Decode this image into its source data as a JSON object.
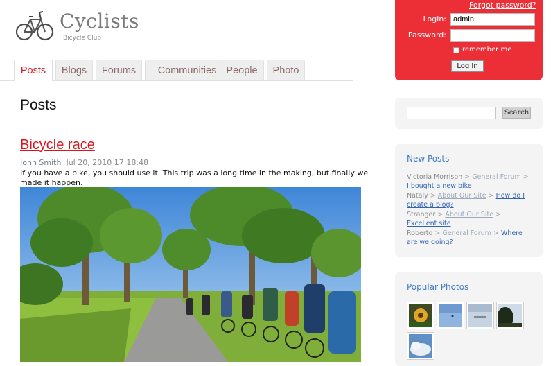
{
  "header": {
    "site_title": "Cyclists",
    "site_subtitle": "Bicycle Club"
  },
  "tabs": [
    {
      "label": "Posts",
      "active": true
    },
    {
      "label": "Blogs",
      "active": false
    },
    {
      "label": "Forums",
      "active": false
    },
    {
      "label": "Communities",
      "active": false
    },
    {
      "label": "People",
      "active": false
    },
    {
      "label": "Photo",
      "active": false
    }
  ],
  "login": {
    "forgot_label": "Forgot password?",
    "login_label": "Login:",
    "login_value": "admin",
    "password_label": "Password:",
    "password_value": "",
    "remember_label": "remember me",
    "submit_label": "Log In"
  },
  "main": {
    "heading": "Posts",
    "post": {
      "title": "Bicycle race",
      "author": "John Smith",
      "date": "Jul 20, 2010 17:18:48",
      "body": "If you have a bike, you should use it. This trip was a long time in the making, but finally we made it happen."
    }
  },
  "search": {
    "button_label": "Search"
  },
  "new_posts": {
    "heading": "New Posts",
    "items": [
      {
        "user": "Victoria Morrison",
        "forum": "General Forum",
        "title": "I bought a new bike!"
      },
      {
        "user": "Nataly",
        "forum": "About Our Site",
        "title": "How do I create a blog?"
      },
      {
        "user": "Stranger",
        "forum": "About Our Site",
        "title": "Excellent site"
      },
      {
        "user": "Roberto",
        "forum": "General Forum",
        "title": "Where are we going?"
      }
    ]
  },
  "popular_photos": {
    "heading": "Popular Photos"
  },
  "colors": {
    "brand_red": "#ec2f37",
    "link_blue": "#3264b4",
    "heading_blue": "#3d7dc4"
  },
  "icons": [
    "bicycle-logo-icon"
  ]
}
